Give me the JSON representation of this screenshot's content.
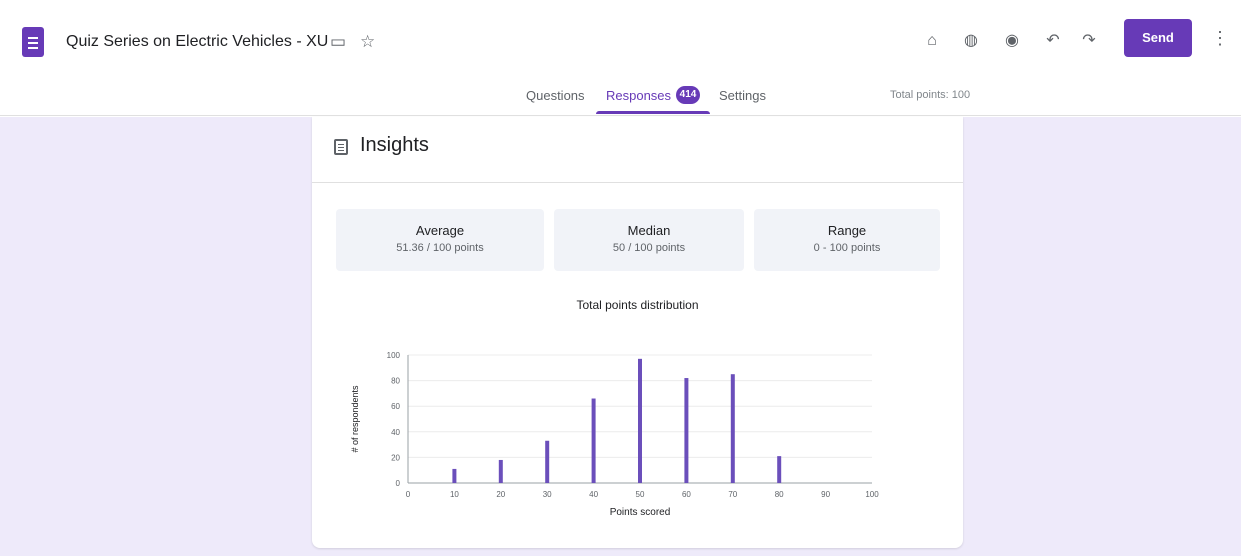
{
  "header": {
    "title": "Quiz Series on Electric Vehicles - XU",
    "send_label": "Send"
  },
  "tabs": [
    {
      "label": "Questions"
    },
    {
      "label": "Responses"
    },
    {
      "label": "Settings"
    }
  ],
  "responses_badge": "414",
  "total_points": "Total points: 100",
  "insights": {
    "title": "Insights",
    "stats": [
      {
        "label": "Average",
        "value": "51.36 / 100 points"
      },
      {
        "label": "Median",
        "value": "50 / 100 points"
      },
      {
        "label": "Range",
        "value": "0 - 100 points"
      }
    ]
  },
  "icons": {
    "doc": "forms-doc-icon",
    "folder": "folder-icon",
    "star": "star-icon",
    "palette": "palette-icon",
    "preview": "eye-preview-icon",
    "undo": "undo-icon",
    "redo": "redo-icon",
    "more": "more-vert-icon"
  },
  "colors": {
    "accent": "#673ab7",
    "background": "#eeeafa",
    "bar": "#6b4fbb"
  },
  "chart_data": {
    "type": "bar",
    "title": "Total points distribution",
    "xlabel": "Points scored",
    "ylabel": "# of respondents",
    "x": [
      0,
      10,
      20,
      30,
      40,
      50,
      60,
      70,
      80,
      90,
      100
    ],
    "values": [
      0,
      11,
      18,
      33,
      66,
      97,
      82,
      85,
      21,
      0,
      0
    ],
    "xlim": [
      0,
      100
    ],
    "ylim": [
      0,
      100
    ],
    "yticks": [
      0,
      20,
      40,
      60,
      80,
      100
    ],
    "grid": true
  }
}
